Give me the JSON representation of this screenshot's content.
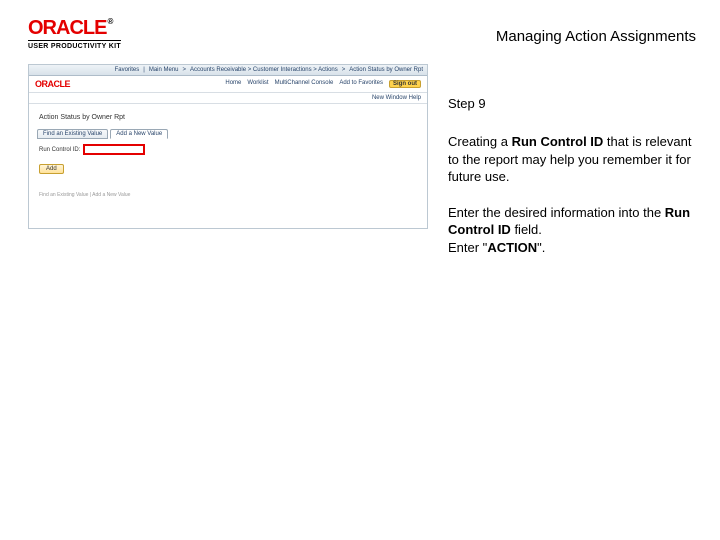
{
  "header": {
    "brand": "ORACLE",
    "tm": "®",
    "subbrand": "USER PRODUCTIVITY KIT",
    "title": "Managing Action Assignments"
  },
  "app": {
    "topbar": {
      "favorites": "Favorites",
      "menu": "Main Menu",
      "path": "Accounts Receivable > Customer Interactions > Actions",
      "page": "Action Status by Owner Rpt",
      "home": "Home",
      "worklist": "Worklist",
      "multichannel": "MultiChannel Console",
      "addto": "Add to Favorites",
      "signout": "Sign out"
    },
    "mini_brand": "ORACLE",
    "newwindow": "New Window",
    "help": "Help",
    "page_title": "Action Status by Owner Rpt",
    "tabs": {
      "find": "Find an Existing Value",
      "add": "Add a New Value"
    },
    "field_label": "Run Control ID:",
    "add_button": "Add",
    "footer": "Find an Existing Value | Add a New Value"
  },
  "instructions": {
    "step": "Step 9",
    "p1_a": "Creating a ",
    "p1_b": "Run Control ID",
    "p1_c": " that is relevant to the report may help you remember it for future use.",
    "p2_a": "Enter the desired information into the ",
    "p2_b": "Run Control ID",
    "p2_c": " field.",
    "p3_a": "Enter \"",
    "p3_b": "ACTION",
    "p3_c": "\"."
  }
}
